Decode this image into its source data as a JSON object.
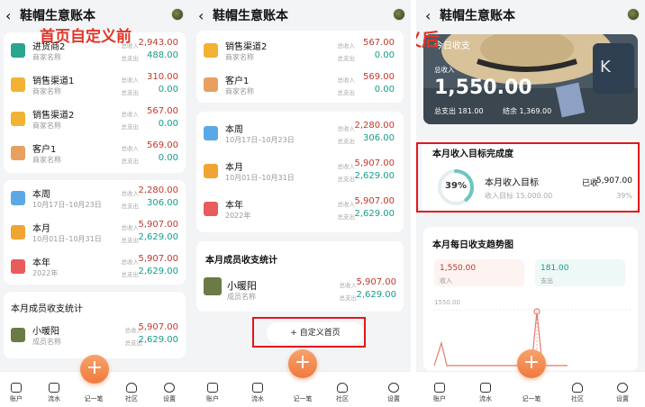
{
  "app_title": "鞋帽生意账本",
  "labels": {
    "income": "总收入",
    "expense": "总支出",
    "shop_name": "商家名称",
    "member_name": "成员名称"
  },
  "overlay_before": "首页自定义前",
  "overlay_after": "首页自定义后",
  "panel1": {
    "parties": [
      {
        "name": "进货商2",
        "sub": "商家名称",
        "income": "2,943.00",
        "expense": "488.00"
      },
      {
        "name": "销售渠道1",
        "sub": "商家名称",
        "income": "310.00",
        "expense": "0.00"
      },
      {
        "name": "销售渠道2",
        "sub": "商家名称",
        "income": "567.00",
        "expense": "0.00"
      },
      {
        "name": "客户1",
        "sub": "商家名称",
        "income": "569.00",
        "expense": "0.00"
      }
    ],
    "periods": [
      {
        "name": "本周",
        "sub": "10月17日–10月23日",
        "income": "2,280.00",
        "expense": "306.00"
      },
      {
        "name": "本月",
        "sub": "10月01日–10月31日",
        "income": "5,907.00",
        "expense": "2,629.00"
      },
      {
        "name": "本年",
        "sub": "2022年",
        "income": "5,907.00",
        "expense": "2,629.00"
      }
    ],
    "members_title": "本月成员收支统计",
    "member": {
      "name": "小暖阳",
      "sub": "成员名称",
      "income": "5,907.00",
      "expense": "2,629.00"
    }
  },
  "panel2": {
    "parties": [
      {
        "name": "销售渠道2",
        "sub": "商家名称",
        "income": "567.00",
        "expense": "0.00"
      },
      {
        "name": "客户1",
        "sub": "商家名称",
        "income": "569.00",
        "expense": "0.00"
      }
    ],
    "periods": [
      {
        "name": "本周",
        "sub": "10月17日–10月23日",
        "income": "2,280.00",
        "expense": "306.00"
      },
      {
        "name": "本月",
        "sub": "10月01日–10月31日",
        "income": "5,907.00",
        "expense": "2,629.00"
      },
      {
        "name": "本年",
        "sub": "2022年",
        "income": "5,907.00",
        "expense": "2,629.00"
      }
    ],
    "members_title": "本月成员收支统计",
    "member": {
      "name": "小暖阳",
      "sub": "成员名称",
      "income": "5,907.00",
      "expense": "2,629.00"
    },
    "custom_button": "+ 自定义首页"
  },
  "panel3": {
    "hero": {
      "title": "今日收支",
      "income_label": "总收入",
      "income_value": "1,550.00",
      "expense_text": "总支出 181.00",
      "balance_text": "结余 1,369.00"
    },
    "goal": {
      "section_title": "本月收入目标完成度",
      "percent": 39,
      "percent_text": "39%",
      "name": "本月收入目标",
      "received_label": "已收",
      "received_value": "5,907.00",
      "target_text": "收入目标 15,000.00",
      "percent_small": "39%"
    },
    "trend": {
      "section_title": "本月每日收支趋势图",
      "income_value": "1,550.00",
      "income_label": "收入",
      "expense_value": "181.00",
      "expense_label": "支出",
      "y_top": "1550.00"
    }
  },
  "tabs": [
    "账户",
    "流水",
    "记一笔",
    "社区",
    "设置"
  ],
  "colors": {
    "income": "#c0392b",
    "expense": "#159c8a",
    "accent": "#f07a3e",
    "highlight": "#e3161b"
  }
}
